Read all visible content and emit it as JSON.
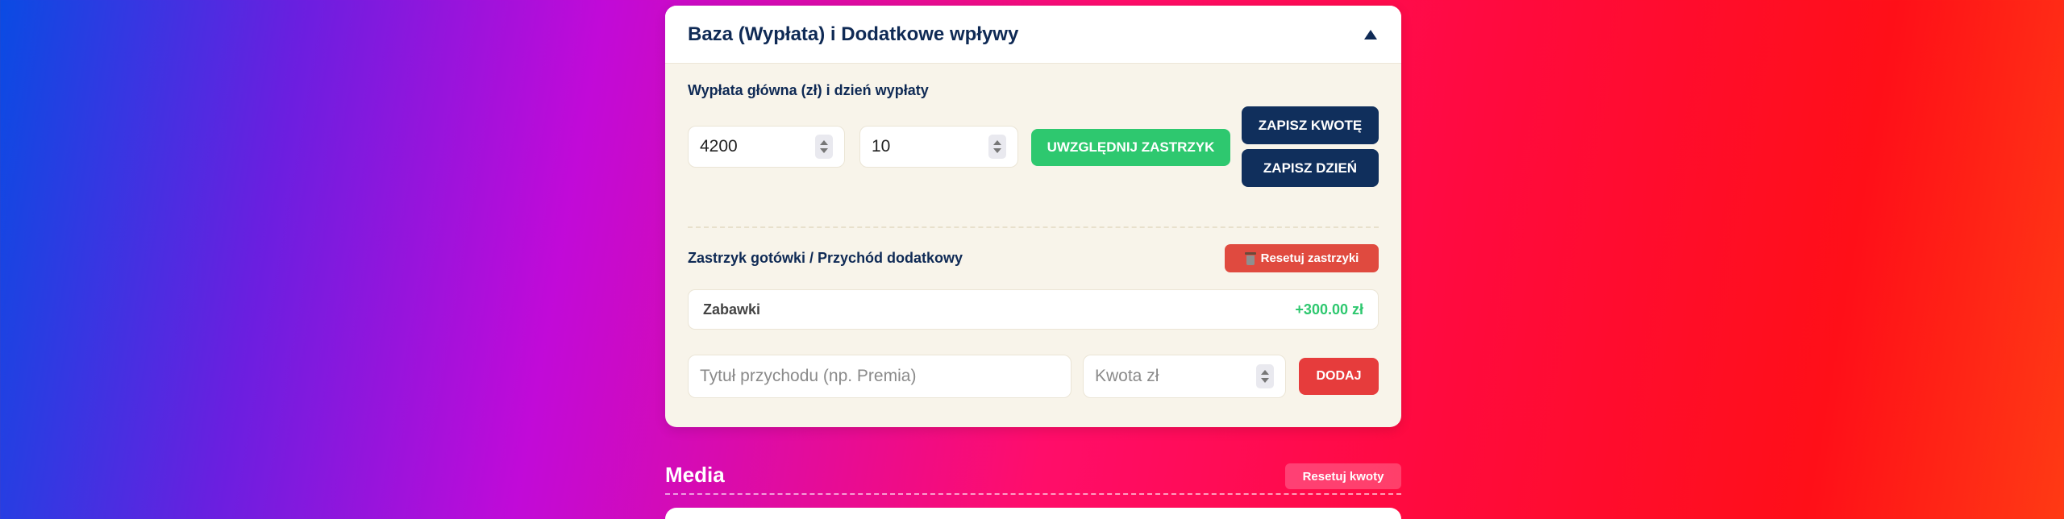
{
  "panel": {
    "title": "Baza (Wypłata) i Dodatkowe wpływy",
    "salary_label": "Wypłata główna (zł) i dzień wypłaty",
    "salary_value": "4200",
    "payday_value": "10",
    "include_injection_label": "UWZGLĘDNIJ ZASTRZYK",
    "save_amount_label": "ZAPISZ KWOTĘ",
    "save_day_label": "ZAPISZ DZIEŃ",
    "injection_label": "Zastrzyk gotówki / Przychód dodatkowy",
    "reset_injections_label": "Resetuj zastrzyki",
    "incomes": [
      {
        "name": "Zabawki",
        "amount": "+300.00 zł"
      }
    ],
    "title_placeholder": "Tytuł przychodu (np. Premia)",
    "amount_placeholder": "Kwota zł",
    "add_label": "DODAJ"
  },
  "media": {
    "title": "Media",
    "reset_label": "Resetuj kwoty"
  },
  "colors": {
    "navy": "#102f5c",
    "green": "#2ec86f",
    "red": "#e63c3c"
  }
}
